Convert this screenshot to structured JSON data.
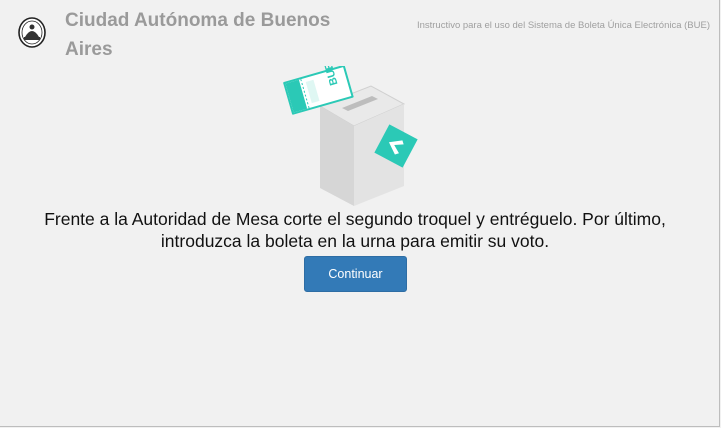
{
  "header": {
    "title": "Ciudad Autónoma de Buenos Aires",
    "subtitle": "Instructivo para el uso del Sistema de Boleta Única Electrónica (BUE)",
    "logo_icon": "city-emblem-icon"
  },
  "illustration": {
    "ballot_label": "BUE",
    "icon": "ballot-box-icon",
    "accent_color": "#2bc9b6"
  },
  "main": {
    "instruction_line1": "Frente a la Autoridad de Mesa corte el segundo troquel y entréguelo. Por último,",
    "instruction_line2": "introduzca la boleta en la urna para emitir su voto."
  },
  "actions": {
    "continue_label": "Continuar",
    "button_color": "#337ab7"
  }
}
